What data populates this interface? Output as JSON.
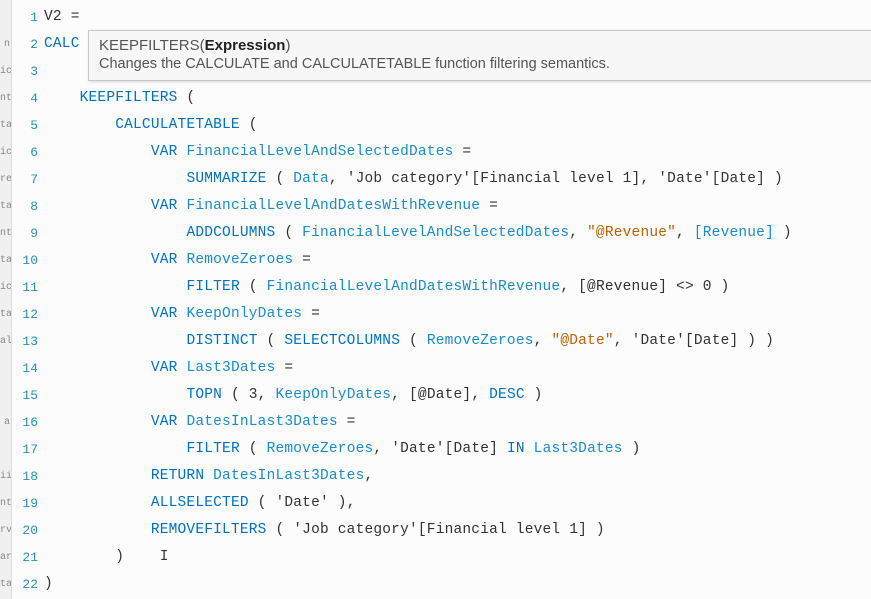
{
  "measure_name": "V2",
  "tooltip": {
    "signature_fn": "KEEPFILTERS",
    "signature_arg": "Expression",
    "description": "Changes the CALCULATE and CALCULATETABLE function filtering semantics."
  },
  "lines": {
    "l1": {
      "num": "1",
      "strip": ""
    },
    "l2": {
      "num": "2",
      "strip": "n",
      "text_prefix": "CALC"
    },
    "l3": {
      "num": "3",
      "strip": "ic"
    },
    "l4": {
      "num": "4",
      "strip": "nt",
      "kw": "KEEPFILTERS",
      "rest": " ("
    },
    "l5": {
      "num": "5",
      "strip": "ta",
      "fn": "CALCULATETABLE",
      "rest": " ("
    },
    "l6": {
      "num": "6",
      "strip": "ic",
      "kw": "VAR",
      "var": "FinancialLevelAndSelectedDates",
      "rest": " ="
    },
    "l7": {
      "num": "7",
      "strip": "re",
      "fn": "SUMMARIZE",
      "arg1": "Data",
      "arg2": "'Job category'[Financial level 1]",
      "arg3": "'Date'[Date]"
    },
    "l8": {
      "num": "8",
      "strip": "ta",
      "kw": "VAR",
      "var": "FinancialLevelAndDatesWithRevenue",
      "rest": " ="
    },
    "l9": {
      "num": "9",
      "strip": "nt",
      "fn": "ADDCOLUMNS",
      "arg1": "FinancialLevelAndSelectedDates",
      "str": "\"@Revenue\"",
      "arg3": "[Revenue]"
    },
    "l10": {
      "num": "10",
      "strip": "ta",
      "kw": "VAR",
      "var": "RemoveZeroes",
      "rest": " ="
    },
    "l11": {
      "num": "11",
      "strip": "ic",
      "fn": "FILTER",
      "arg1": "FinancialLevelAndDatesWithRevenue",
      "arg2": "[@Revenue]",
      "op": " <> 0"
    },
    "l12": {
      "num": "12",
      "strip": "ta",
      "kw": "VAR",
      "var": "KeepOnlyDates",
      "rest": " ="
    },
    "l13": {
      "num": "13",
      "strip": "al",
      "fn1": "DISTINCT",
      "fn2": "SELECTCOLUMNS",
      "arg1": "RemoveZeroes",
      "str": "\"@Date\"",
      "arg3": "'Date'[Date]"
    },
    "l14": {
      "num": "14",
      "strip": "",
      "kw": "VAR",
      "var": "Last3Dates",
      "rest": " ="
    },
    "l15": {
      "num": "15",
      "strip": "",
      "fn": "TOPN",
      "n": "3",
      "arg2": "KeepOnlyDates",
      "arg3": "[@Date]",
      "arg4": "DESC"
    },
    "l16": {
      "num": "16",
      "strip": "a",
      "kw": "VAR",
      "var": "DatesInLast3Dates",
      "rest": " ="
    },
    "l17": {
      "num": "17",
      "strip": "",
      "fn": "FILTER",
      "arg1": "RemoveZeroes",
      "arg2": "'Date'[Date]",
      "kw2": "IN",
      "arg3": "Last3Dates"
    },
    "l18": {
      "num": "18",
      "strip": "ii",
      "kw": "RETURN",
      "var": "DatesInLast3Dates"
    },
    "l19": {
      "num": "19",
      "strip": "nt",
      "fn": "ALLSELECTED",
      "arg": "'Date'"
    },
    "l20": {
      "num": "20",
      "strip": "rv",
      "fn": "REMOVEFILTERS",
      "arg": "'Job category'[Financial level 1]"
    },
    "l21": {
      "num": "21",
      "strip": "ar"
    },
    "l22": {
      "num": "22",
      "strip": "ta"
    }
  }
}
